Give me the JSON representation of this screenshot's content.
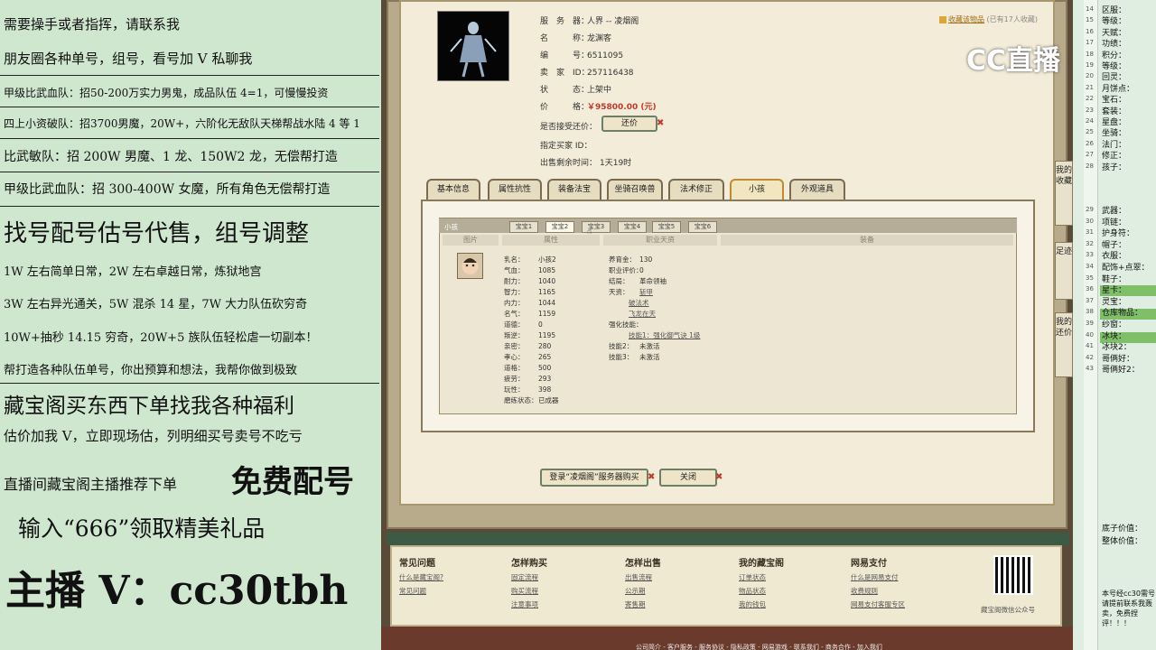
{
  "left": {
    "lines": [
      "需要操手或者指挥，请联系我",
      "朋友圈各种单号，组号，看号加 V 私聊我",
      "甲级比武血队：招50-200万实力男鬼，成品队伍 4=1，可慢慢投资",
      "四上小资破队：招3700男魔，20W+，六阶化无敌队天梯帮战水陆 4 等 1",
      "比武敏队：招 200W 男魔、1 龙、150W2 龙，无偿帮打造",
      "甲级比武血队：招 300-400W 女魔，所有角色无偿帮打造",
      "找号配号估号代售，组号调整",
      "1W 左右简单日常，2W 左右卓越日常，炼狱地宫",
      "3W 左右异光通关，5W 混杀 14 星，7W 大力队伍砍穷奇",
      "10W+抽秒 14.15 穷奇，20W+5 族队伍轻松虐一切副本！",
      "帮打造各种队伍单号，你出预算和想法，我帮你做到极致",
      "藏宝阁买东西下单找我各种福利",
      "估价加我 V，立即现场估，列明细买号卖号不吃亏",
      "直播间藏宝阁主播推荐下单",
      "免费配号",
      "输入“666”领取精美礼品",
      "主播 V：cc30tbh"
    ]
  },
  "item": {
    "server_label": "服　务　器：",
    "server_value": "人界 -- 凌烟阁",
    "name_label": "名　　　称：",
    "name_value": "龙渊客",
    "id_label": "编　　　号：",
    "id_value": "6511095",
    "seller_label": "卖　家　ID：",
    "seller_value": "257116438",
    "status_label": "状　　　态：",
    "status_value": "上架中",
    "price_label": "价　　　格：",
    "price_value": "￥95800.00 (元)",
    "counter_label": "是否接受还价：",
    "counter_button": "还价",
    "buyer_label": "指定买家 ID：",
    "buyer_value": "",
    "remaining_label": "出售剩余时间：",
    "remaining_value": "1天19时",
    "fav_label": "收藏该物品",
    "fav_count": "(已有17人收藏)"
  },
  "tabs": [
    "基本信息",
    "属性抗性",
    "装备法宝",
    "坐骑召唤兽",
    "法术修正",
    "小孩",
    "外观道具"
  ],
  "active_tab": "小孩",
  "child_panel": {
    "header": "小孩",
    "subtabs": [
      "宝宝1",
      "宝宝2",
      "宝宝3",
      "宝宝4",
      "宝宝5",
      "宝宝6"
    ],
    "columns": [
      "图片",
      "属性",
      "职业天资",
      "装备"
    ],
    "stats_left": [
      [
        "乳名：",
        "小孩2"
      ],
      [
        "气血：",
        "1085"
      ],
      [
        "耐力：",
        "1040"
      ],
      [
        "智力：",
        "1165"
      ],
      [
        "内力：",
        "1044"
      ],
      [
        "名气：",
        "1159"
      ],
      [
        "道德：",
        "0"
      ],
      [
        "叛逆：",
        "1195"
      ],
      [
        "亲密：",
        "280"
      ],
      [
        "孝心：",
        "265"
      ],
      [
        "道格：",
        "500"
      ],
      [
        "疲劳：",
        "293"
      ],
      [
        "玩性：",
        "398"
      ],
      [
        "磨练状态：",
        "已成器"
      ]
    ],
    "stats_right": [
      [
        "养育金：",
        "130"
      ],
      [
        "职业评价：",
        "0"
      ],
      [
        "结局：",
        "革命领袖"
      ],
      [
        "天资：",
        "斩甲"
      ],
      [
        "",
        "破法术"
      ],
      [
        "",
        "飞龙在天"
      ],
      [
        "强化技能：",
        ""
      ],
      [
        "",
        "技能1：强化御气诀 1级"
      ],
      [
        "技能2：",
        "未激活"
      ],
      [
        "技能3：",
        "未激活"
      ]
    ]
  },
  "buttons": {
    "buy": "登录“凌烟阁”服务器购买",
    "close": "关闭"
  },
  "side_buttons": [
    "我的收藏",
    "足迹",
    "我的还价"
  ],
  "footer": {
    "cols": [
      {
        "title": "常见问题",
        "links": [
          "什么是藏宝阁?",
          "常见问题"
        ]
      },
      {
        "title": "怎样购买",
        "links": [
          "固定流程",
          "购买流程",
          "注意事项"
        ]
      },
      {
        "title": "怎样出售",
        "links": [
          "出售流程",
          "公示期",
          "寄售期"
        ]
      },
      {
        "title": "我的藏宝阁",
        "links": [
          "订单状态",
          "物品状态",
          "我的钱包"
        ]
      },
      {
        "title": "网易支付",
        "links": [
          "什么是网易支付",
          "收费规则",
          "网易支付客服专区"
        ]
      }
    ],
    "qr_label": "藏宝阁微信公众号",
    "bottom_links": "公司简介 - 客户服务 - 服务协议 - 隐私政策 - 网易游戏 - 联系我们 - 商务合作 - 加入我们"
  },
  "watermark": "CC直播",
  "right": {
    "rows": [
      {
        "n": "14",
        "t": "区服："
      },
      {
        "n": "15",
        "t": "等级："
      },
      {
        "n": "16",
        "t": "天赋："
      },
      {
        "n": "17",
        "t": "功绩："
      },
      {
        "n": "18",
        "t": "积分："
      },
      {
        "n": "19",
        "t": "等级："
      },
      {
        "n": "20",
        "t": "回灵："
      },
      {
        "n": "21",
        "t": "月饼点："
      },
      {
        "n": "22",
        "t": "宝石："
      },
      {
        "n": "23",
        "t": "套装："
      },
      {
        "n": "24",
        "t": "星盘："
      },
      {
        "n": "25",
        "t": "坐骑："
      },
      {
        "n": "26",
        "t": "法门："
      },
      {
        "n": "27",
        "t": "修正："
      },
      {
        "n": "28",
        "t": "孩子："
      },
      {
        "n": "29",
        "t": "武器："
      },
      {
        "n": "30",
        "t": "项链："
      },
      {
        "n": "31",
        "t": "护身符："
      },
      {
        "n": "32",
        "t": "帽子："
      },
      {
        "n": "33",
        "t": "衣服："
      },
      {
        "n": "34",
        "t": "配饰+点翠："
      },
      {
        "n": "35",
        "t": "鞋子："
      },
      {
        "n": "36",
        "t": "星卡："
      },
      {
        "n": "37",
        "t": "灵宝："
      },
      {
        "n": "38",
        "t": "仓库物品："
      },
      {
        "n": "39",
        "t": "纱窗："
      },
      {
        "n": "40",
        "t": "冰块："
      },
      {
        "n": "41",
        "t": "冰块2："
      },
      {
        "n": "42",
        "t": "哥俩好："
      },
      {
        "n": "43",
        "t": "哥俩好2："
      }
    ],
    "bottom_rows": [
      "底子价值：",
      "整体价值："
    ],
    "note": "本号经cc30需号请提前联系我轰卖，免费捏评！！！"
  }
}
